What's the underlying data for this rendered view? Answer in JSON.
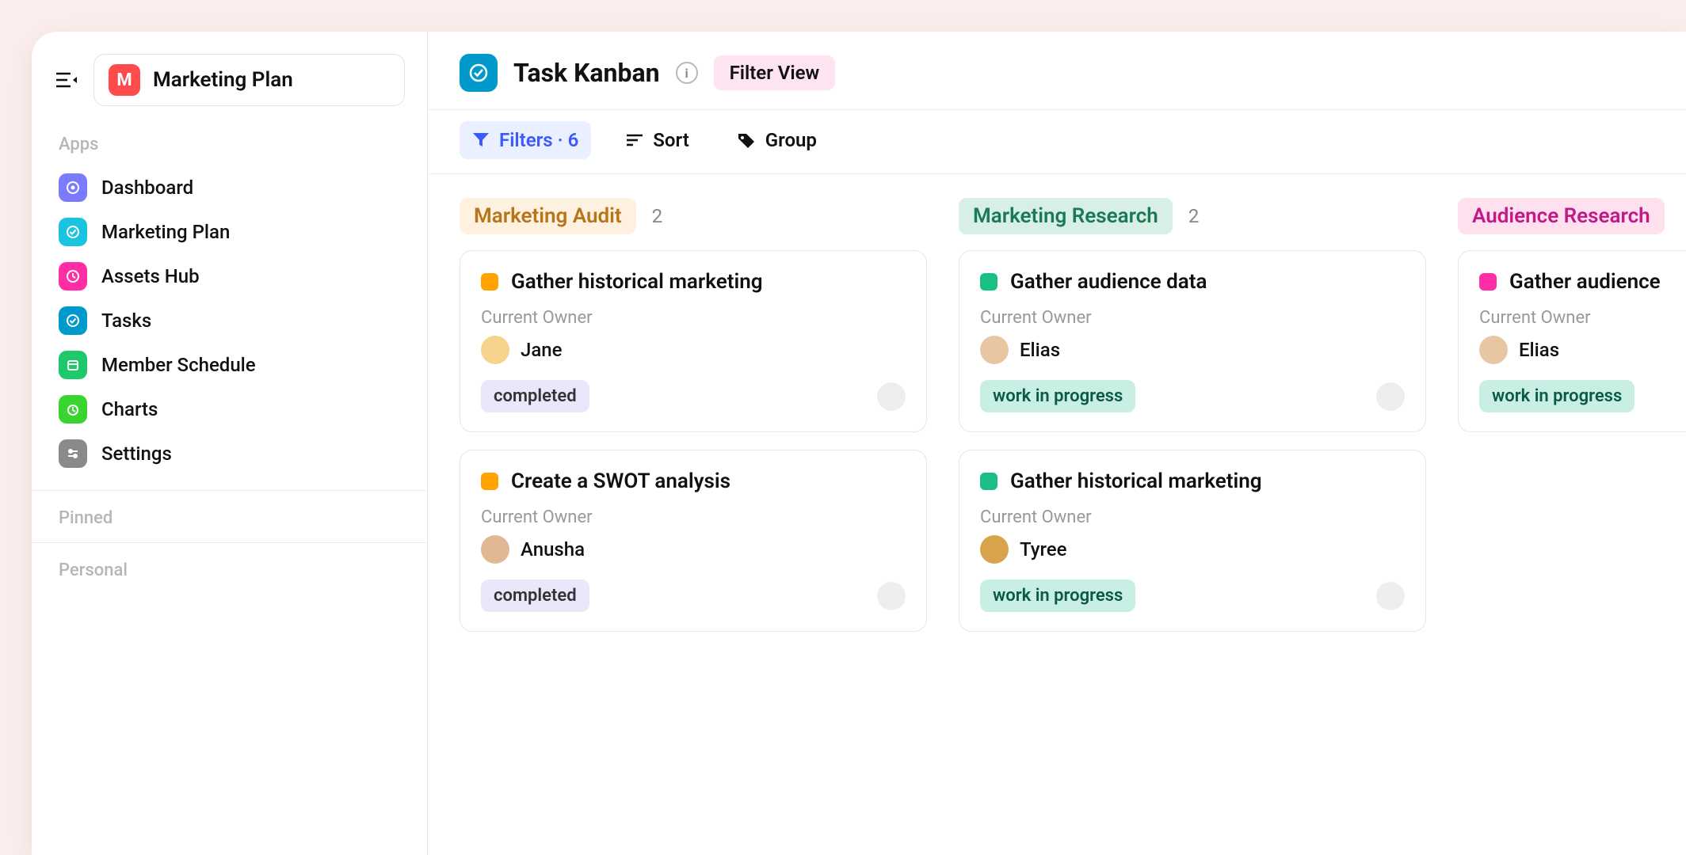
{
  "workspace": {
    "initial": "M",
    "name": "Marketing Plan"
  },
  "sidebar": {
    "section_apps": "Apps",
    "section_pinned": "Pinned",
    "section_personal": "Personal",
    "items": [
      {
        "label": "Dashboard",
        "icon_bg": "#7b7bff"
      },
      {
        "label": "Marketing Plan",
        "icon_bg": "#18c4e0"
      },
      {
        "label": "Assets  Hub",
        "icon_bg": "#ff2ea6"
      },
      {
        "label": "Tasks",
        "icon_bg": "#0099cc"
      },
      {
        "label": "Member Schedule",
        "icon_bg": "#1ec96b"
      },
      {
        "label": "Charts",
        "icon_bg": "#38d430"
      },
      {
        "label": "Settings",
        "icon_bg": "#8a8a8a"
      }
    ]
  },
  "header": {
    "title": "Task Kanban",
    "filter_view": "Filter View"
  },
  "toolbar": {
    "filters_label": "Filters · 6",
    "sort_label": "Sort",
    "group_label": "Group"
  },
  "columns": [
    {
      "title": "Marketing Audit",
      "count": "2",
      "title_bg": "#fff1e0",
      "title_color": "#b87418",
      "status_color": "#ffa300",
      "cards": [
        {
          "title": "Gather historical marketing",
          "owner_label": "Current Owner",
          "owner": "Jane",
          "avatar_bg": "#f6d28b",
          "status": "completed",
          "status_bg": "#ebe7fb",
          "status_fg": "#333"
        },
        {
          "title": "Create a SWOT analysis",
          "owner_label": "Current Owner",
          "owner": "Anusha",
          "avatar_bg": "#e2b893",
          "status": "completed",
          "status_bg": "#ebe7fb",
          "status_fg": "#333"
        }
      ]
    },
    {
      "title": "Marketing Research",
      "count": "2",
      "title_bg": "#d7efe4",
      "title_color": "#1a7a58",
      "status_color": "#1abf83",
      "cards": [
        {
          "title": "Gather audience data",
          "owner_label": "Current Owner",
          "owner": "Elias",
          "avatar_bg": "#e8c6a4",
          "status": "work in progress",
          "status_bg": "#c9efe4",
          "status_fg": "#0a5a44"
        },
        {
          "title": "Gather historical marketing",
          "owner_label": "Current Owner",
          "owner": "Tyree",
          "avatar_bg": "#d8a34b",
          "status": "work in progress",
          "status_bg": "#c9efe4",
          "status_fg": "#0a5a44"
        }
      ]
    },
    {
      "title": "Audience Research",
      "count": "",
      "title_bg": "#ffe0ef",
      "title_color": "#c21888",
      "status_color": "#ff2ea6",
      "cards": [
        {
          "title": "Gather audience",
          "owner_label": "Current Owner",
          "owner": "Elias",
          "avatar_bg": "#e8c6a4",
          "status": "work in progress",
          "status_bg": "#c9efe4",
          "status_fg": "#0a5a44"
        }
      ]
    }
  ]
}
